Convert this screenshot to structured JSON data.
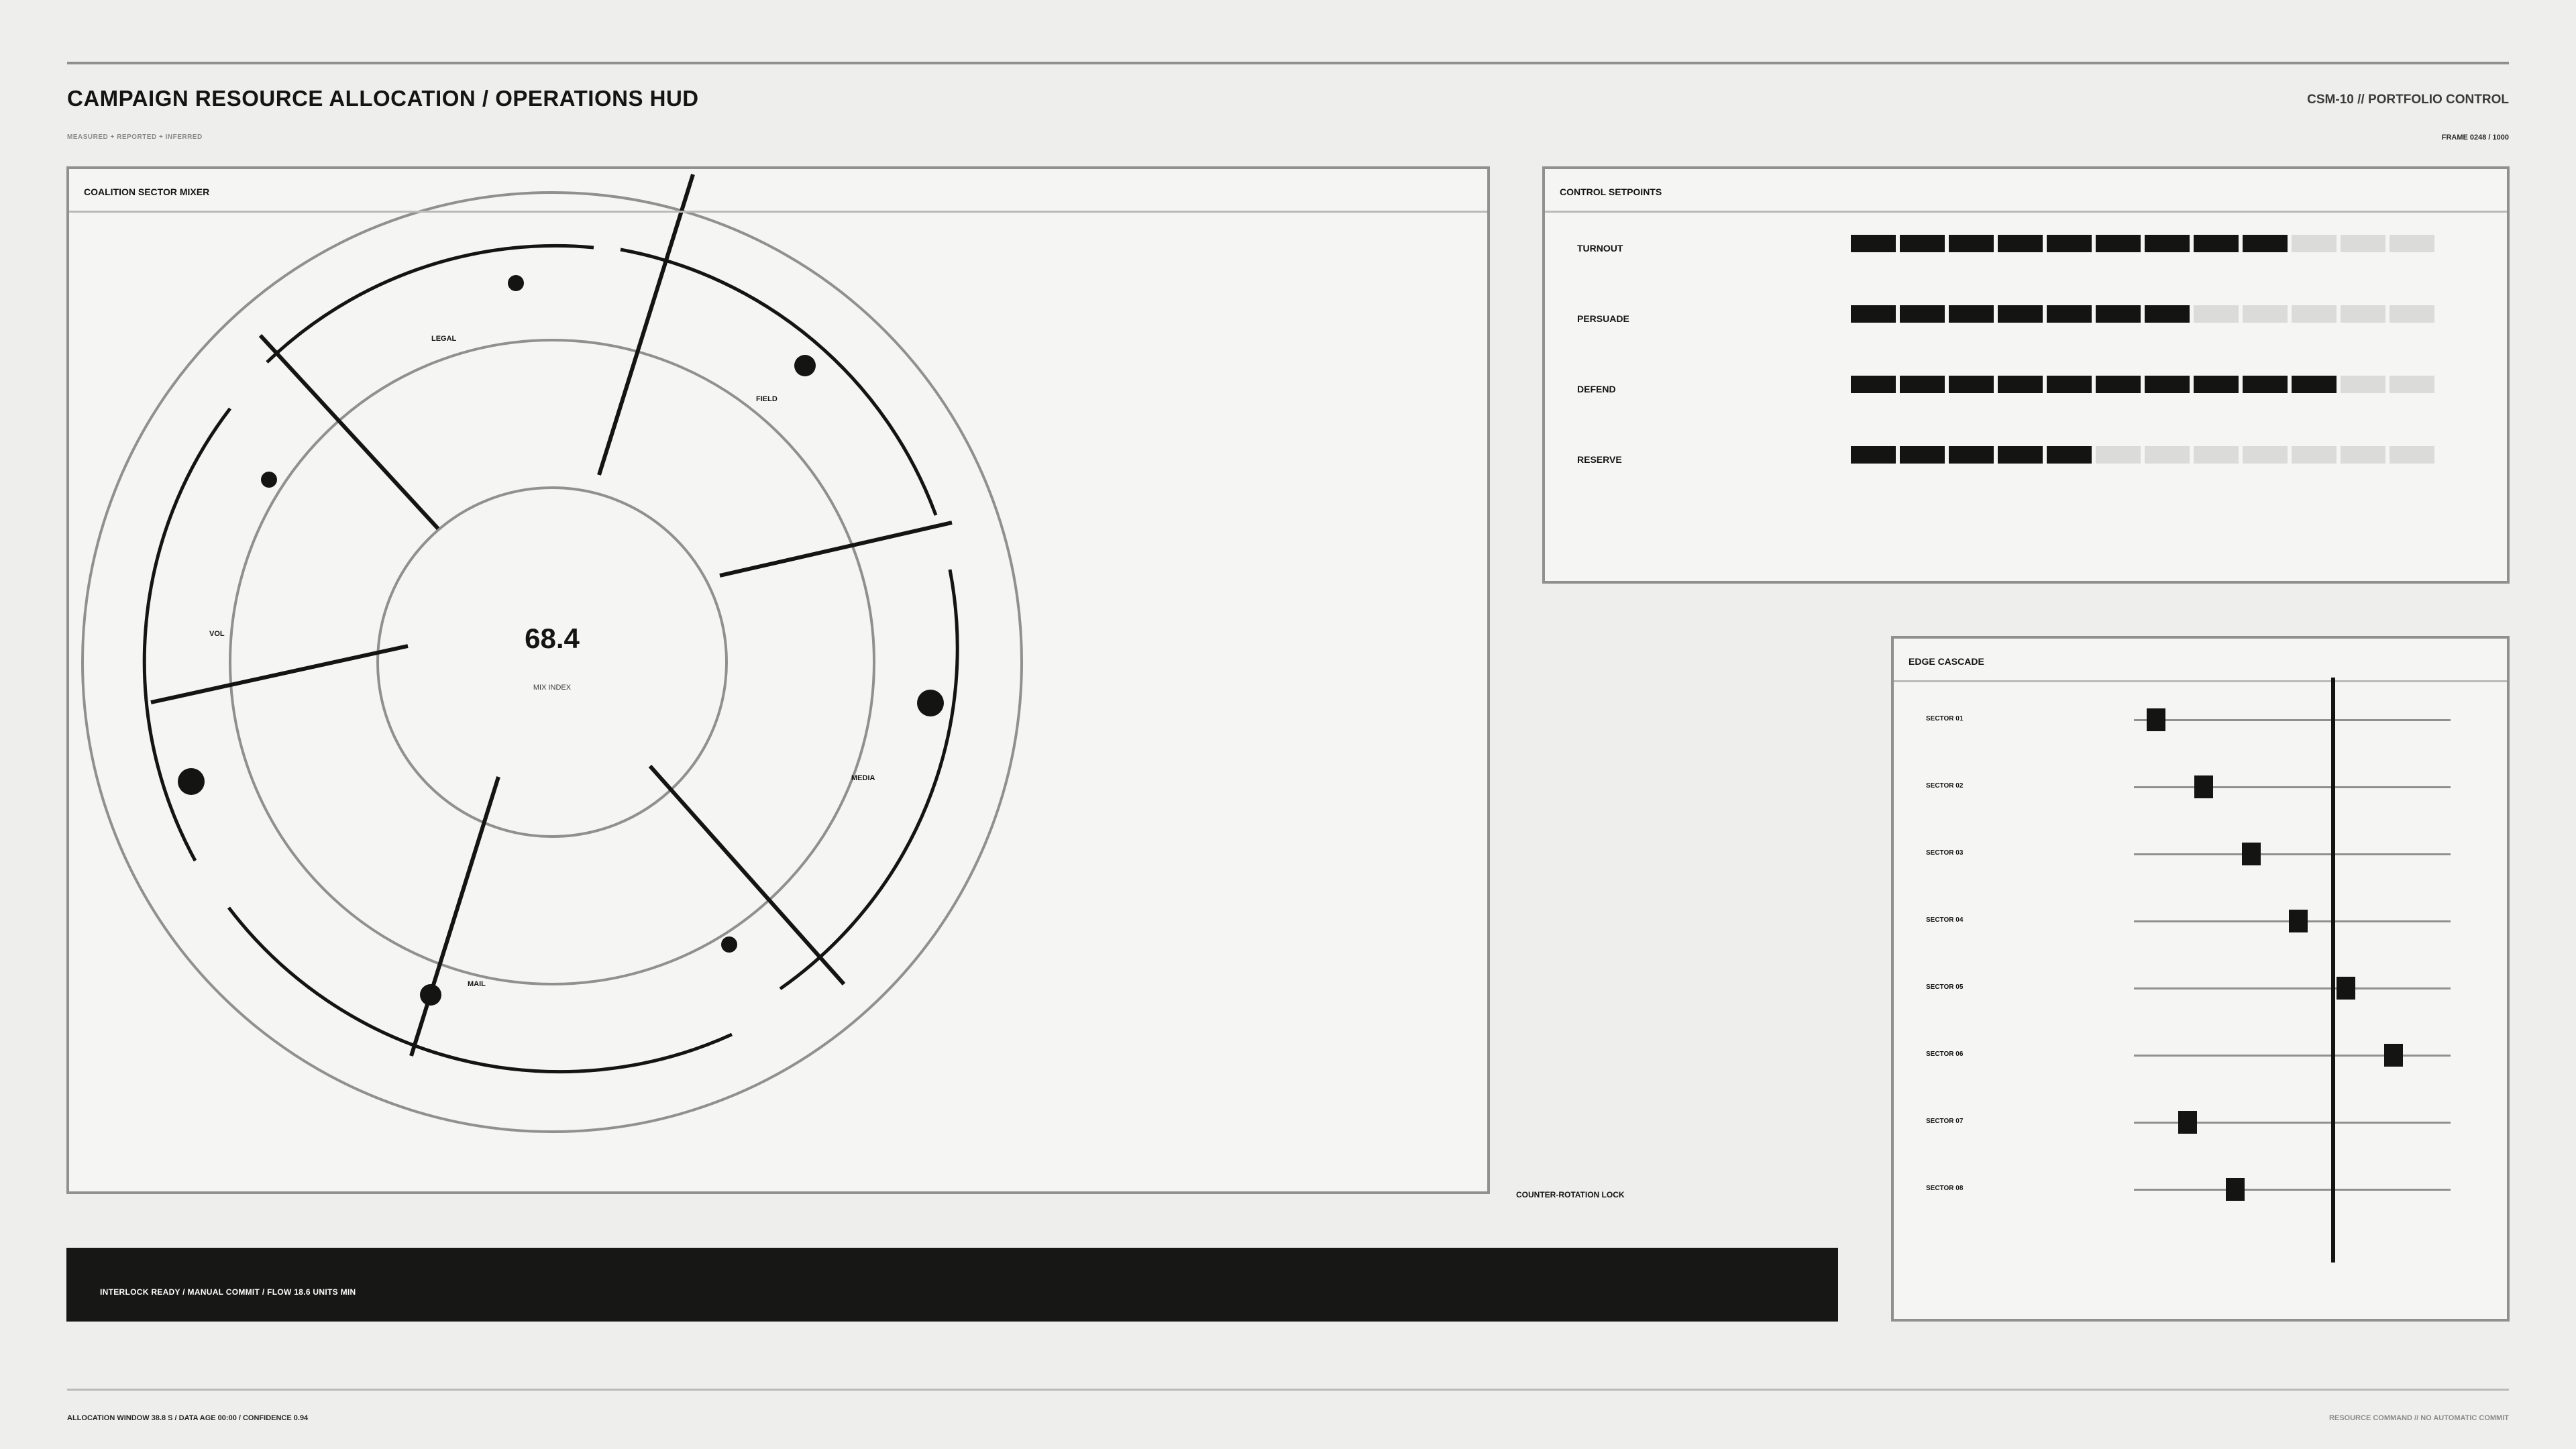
{
  "header": {
    "title": "CAMPAIGN RESOURCE ALLOCATION / OPERATIONS HUD",
    "subtitle": "MEASURED + REPORTED + INFERRED",
    "code": "CSM-10  //  PORTFOLIO CONTROL",
    "frame": "FRAME 0248 / 1000"
  },
  "mixer": {
    "title": "COALITION SECTOR MIXER",
    "center_value": "68.4",
    "center_label": "MIX INDEX",
    "sectors": [
      "LEGAL",
      "FIELD",
      "VOL",
      "MEDIA",
      "MAIL"
    ]
  },
  "setpoints": {
    "title": "CONTROL SETPOINTS",
    "total_segments": 12,
    "rows": [
      {
        "label": "TURNOUT",
        "level": 9
      },
      {
        "label": "PERSUADE",
        "level": 7
      },
      {
        "label": "DEFEND",
        "level": 10
      },
      {
        "label": "RESERVE",
        "level": 5
      }
    ]
  },
  "cascade": {
    "title": "EDGE CASCADE",
    "lock_position": 0.63,
    "rows": [
      {
        "label": "SECTOR 01",
        "value": 0.07
      },
      {
        "label": "SECTOR 02",
        "value": 0.22
      },
      {
        "label": "SECTOR 03",
        "value": 0.37
      },
      {
        "label": "SECTOR 04",
        "value": 0.52
      },
      {
        "label": "SECTOR 05",
        "value": 0.67
      },
      {
        "label": "SECTOR 06",
        "value": 0.82
      },
      {
        "label": "SECTOR 07",
        "value": 0.17
      },
      {
        "label": "SECTOR 08",
        "value": 0.32
      }
    ]
  },
  "lock_label": "COUNTER-ROTATION LOCK",
  "status": "INTERLOCK READY / MANUAL COMMIT / FLOW 18.6 UNITS MIN",
  "footer": {
    "left": "ALLOCATION WINDOW 38.8 S  /  DATA AGE 00:00  /  CONFIDENCE 0.94",
    "right": "RESOURCE COMMAND // NO AUTOMATIC COMMIT"
  },
  "colors": {
    "ink": "#141513",
    "rule": "#8f918d",
    "panel": "#f5f6f3",
    "off": "#dbdcd9",
    "bg": "#eeefec"
  }
}
